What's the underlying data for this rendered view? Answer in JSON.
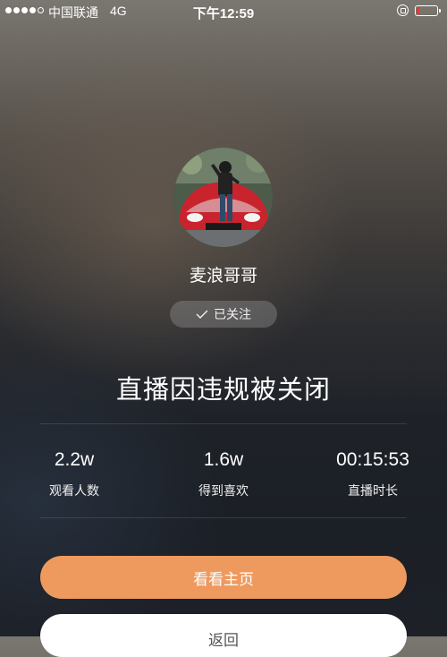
{
  "status_bar": {
    "carrier": "中国联通",
    "network": "4G",
    "time": "下午12:59",
    "signal_bars_filled": 4,
    "signal_bars_total": 5,
    "battery_level": 0.12,
    "battery_color": "#e53935"
  },
  "profile": {
    "avatar_icon": "avatar-photo",
    "username": "麦浪哥哥",
    "follow_label": "已关注",
    "follow_icon": "check-icon"
  },
  "notice": {
    "title": "直播因违规被关闭"
  },
  "stats": [
    {
      "value": "2.2w",
      "label": "观看人数"
    },
    {
      "value": "1.6w",
      "label": "得到喜欢"
    },
    {
      "value": "00:15:53",
      "label": "直播时长"
    }
  ],
  "actions": {
    "view_home": "看看主页",
    "back": "返回"
  },
  "colors": {
    "primary_button": "#ee9a5f",
    "back_button": "#ffffff"
  }
}
